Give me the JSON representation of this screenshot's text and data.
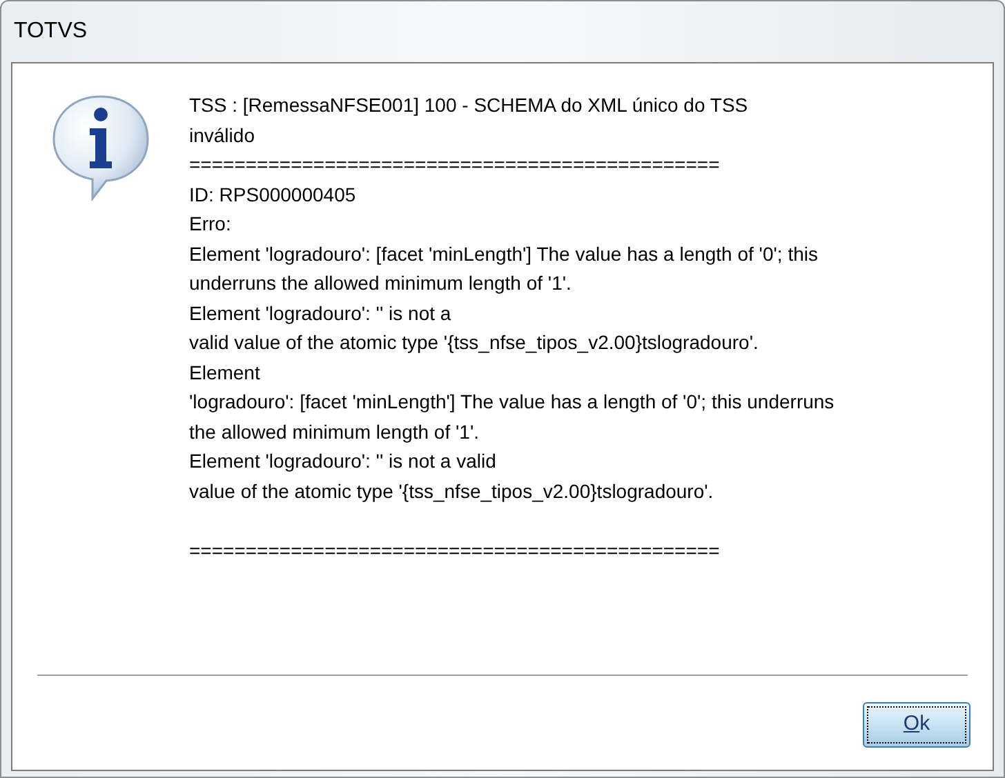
{
  "window": {
    "title": "TOTVS"
  },
  "message": {
    "lines": [
      "TSS : [RemessaNFSE001] 100 - SCHEMA do XML único do TSS",
      "inválido",
      "===============================================",
      "ID: RPS000000405",
      "Erro:",
      "Element 'logradouro': [facet 'minLength'] The value has a length of '0'; this",
      "underruns the allowed minimum length of '1'.",
      "Element 'logradouro': '' is not a",
      "valid value of the atomic type '{tss_nfse_tipos_v2.00}tslogradouro'.",
      "Element",
      "'logradouro': [facet 'minLength'] The value has a length of '0'; this underruns",
      "the allowed minimum length of '1'.",
      "Element 'logradouro': '' is not a valid",
      "value of the atomic type '{tss_nfse_tipos_v2.00}tslogradouro'."
    ],
    "closing_line": "==============================================="
  },
  "buttons": [
    {
      "label": "Ok"
    }
  ]
}
